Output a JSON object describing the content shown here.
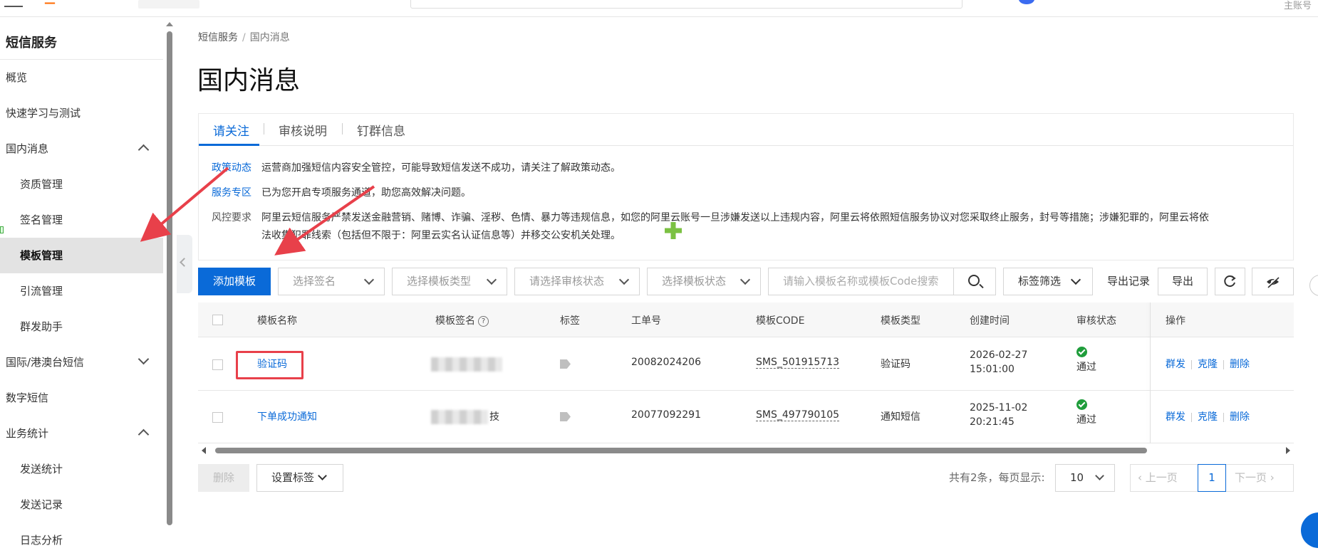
{
  "topbar": {
    "sub_account_fragment": "主账号"
  },
  "sidebar": {
    "title": "短信服务",
    "items": [
      {
        "label": "概览"
      },
      {
        "label": "快速学习与测试"
      },
      {
        "label": "国内消息"
      },
      {
        "label": "资质管理"
      },
      {
        "label": "签名管理"
      },
      {
        "label": "模板管理"
      },
      {
        "label": "引流管理"
      },
      {
        "label": "群发助手"
      },
      {
        "label": "国际/港澳台短信"
      },
      {
        "label": "数字短信"
      },
      {
        "label": "业务统计"
      },
      {
        "label": "发送统计"
      },
      {
        "label": "发送记录"
      },
      {
        "label": "日志分析"
      }
    ]
  },
  "breadcrumb": {
    "root": "短信服务",
    "sep": "/",
    "current": "国内消息"
  },
  "page": {
    "title": "国内消息"
  },
  "notice": {
    "tabs": [
      "请关注",
      "审核说明",
      "钉群信息"
    ],
    "rows": [
      {
        "key": "政策动态",
        "text": "运营商加强短信内容安全管控，可能导致短信发送不成功，请关注了解政策动态。"
      },
      {
        "key": "服务专区",
        "text": "已为您开启专项服务通道，助您高效解决问题。"
      },
      {
        "key": "风控要求",
        "text": "阿里云短信服务严禁发送金融营销、赌博、诈骗、淫秽、色情、暴力等违规信息，如您的阿里云账号一旦涉嫌发送以上违规内容，阿里云将依照短信服务协议对您采取终止服务，封号等措施；涉嫌犯罪的，阿里云将依",
        "text2": "法收集犯罪线索（包括但不限于：阿里云实名认证信息等）并移交公安机关处理。"
      }
    ]
  },
  "toolbar": {
    "add_label": "添加模板",
    "sign_placeholder": "选择签名",
    "type_placeholder": "选择模板类型",
    "audit_placeholder": "请选择审核状态",
    "status_placeholder": "选择模板状态",
    "search_placeholder": "请输入模板名称或模板Code搜索",
    "tag_filter": "标签筛选",
    "export_records": "导出记录",
    "export": "导出"
  },
  "table": {
    "columns": [
      "模板名称",
      "模板签名",
      "标签",
      "工单号",
      "模板CODE",
      "模板类型",
      "创建时间",
      "审核状态",
      "操作"
    ],
    "rows": [
      {
        "name": "验证码",
        "sign_suffix": "",
        "ticket": "20082024206",
        "code": "SMS_501915713",
        "type": "验证码",
        "date": "2026-02-27",
        "time": "15:01:00",
        "status": "通过"
      },
      {
        "name": "下单成功通知",
        "sign_suffix": "技",
        "ticket": "20077092291",
        "code": "SMS_497790105",
        "type": "通知短信",
        "date": "2025-11-02",
        "time": "20:21:45",
        "status": "通过"
      }
    ],
    "ops": [
      "群发",
      "克隆",
      "删除"
    ]
  },
  "footer": {
    "delete": "删除",
    "set_tag": "设置标签",
    "total": "共有2条，每页显示:",
    "page_size": "10",
    "prev": "上一页",
    "current_page": "1",
    "next": "下一页"
  },
  "colors": {
    "primary": "#0a6ad8",
    "highlight": "#e8404a",
    "success": "#1f9d3b",
    "arrow": "#e8404a"
  }
}
